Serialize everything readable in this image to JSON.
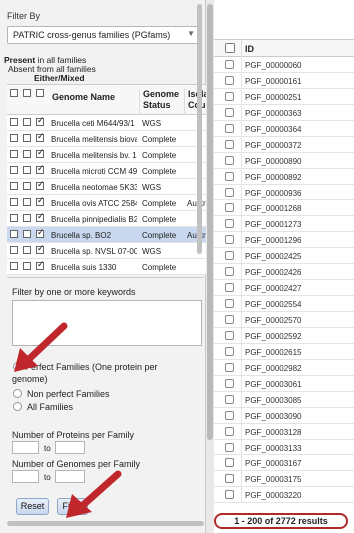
{
  "filter_panel": {
    "filter_by_label": "Filter By",
    "family_select": {
      "value": "PATRIC cross-genus families (PGfams)"
    },
    "legend": {
      "present": "Present",
      "present_suffix": " in all families",
      "absent": "Absent from all families",
      "either": "Either/Mixed"
    },
    "genome_table": {
      "columns": [
        "Genome Name",
        "Genome Status",
        "Isolation Country"
      ],
      "column_status_line1": "Genome",
      "column_status_line2": "Status",
      "column_iso_line1": "Isola",
      "column_iso_line2": "Cou",
      "rows": [
        {
          "name": "Brucella ceti M644/93/1",
          "status": "WGS",
          "iso": "",
          "selected": false
        },
        {
          "name": "Brucella melitensis biovar",
          "status": "Complete",
          "iso": "",
          "selected": false
        },
        {
          "name": "Brucella melitensis bv. 1",
          "status": "Complete",
          "iso": "",
          "selected": false
        },
        {
          "name": "Brucella microti CCM 491",
          "status": "Complete",
          "iso": "",
          "selected": false
        },
        {
          "name": "Brucella neotomae 5K33",
          "status": "WGS",
          "iso": "",
          "selected": false
        },
        {
          "name": "Brucella ovis ATCC 25840",
          "status": "Complete",
          "iso": "Austr",
          "selected": false
        },
        {
          "name": "Brucella pinnipedialis B2/",
          "status": "Complete",
          "iso": "",
          "selected": false
        },
        {
          "name": "Brucella sp. BO2",
          "status": "Complete",
          "iso": "Austr",
          "selected": true
        },
        {
          "name": "Brucella sp. NVSL 07-002",
          "status": "WGS",
          "iso": "",
          "selected": false
        },
        {
          "name": "Brucella suis 1330",
          "status": "Complete",
          "iso": "",
          "selected": false
        }
      ]
    },
    "keyword_label": "Filter by one or more keywords",
    "keyword_value": "",
    "family_options": {
      "perfect": "Perfect Families (One protein per genome)",
      "non_perfect": "Non perfect Families",
      "all": "All Families",
      "selected": "perfect"
    },
    "num_proteins_label": "Number of Proteins per Family",
    "num_genomes_label": "Number of Genomes per Family",
    "to_label": "to",
    "reset_label": "Reset",
    "filter_label": "Filter"
  },
  "results_panel": {
    "id_header": "ID",
    "ids": [
      "PGF_00000060",
      "PGF_00000161",
      "PGF_00000251",
      "PGF_00000363",
      "PGF_00000364",
      "PGF_00000372",
      "PGF_00000890",
      "PGF_00000892",
      "PGF_00000936",
      "PGF_00001268",
      "PGF_00001273",
      "PGF_00001296",
      "PGF_00002425",
      "PGF_00002426",
      "PGF_00002427",
      "PGF_00002554",
      "PGF_00002570",
      "PGF_00002592",
      "PGF_00002615",
      "PGF_00002982",
      "PGF_00003061",
      "PGF_00003085",
      "PGF_00003090",
      "PGF_00003128",
      "PGF_00003133",
      "PGF_00003167",
      "PGF_00003175",
      "PGF_00003220"
    ],
    "result_count": "1 - 200 of 2772 results"
  },
  "colors": {
    "annotation_arrow": "#c0272d",
    "selected_row": "#c9d8ee",
    "button_border": "#8ea7c9"
  }
}
